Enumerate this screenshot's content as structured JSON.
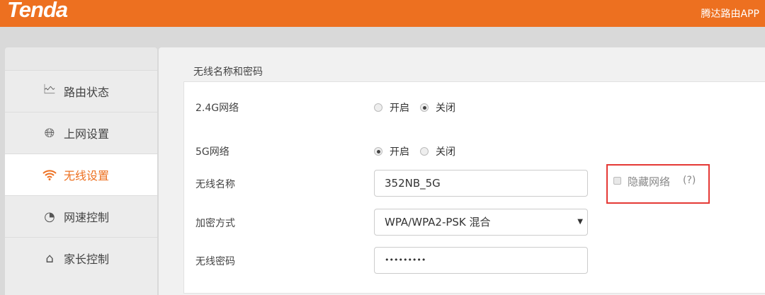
{
  "header": {
    "logo": "Tenda",
    "app_link": "腾达路由APP",
    "color": "#ed7020"
  },
  "sidebar": {
    "items": [
      {
        "label": "路由状态",
        "icon": "pulse-monitor-icon"
      },
      {
        "label": "上网设置",
        "icon": "globe-icon"
      },
      {
        "label": "无线设置",
        "icon": "wifi-icon",
        "active": true
      },
      {
        "label": "网速控制",
        "icon": "speedometer-icon"
      },
      {
        "label": "家长控制",
        "icon": "family-icon"
      }
    ]
  },
  "main": {
    "section_title": "无线名称和密码",
    "net24": {
      "label": "2.4G网络",
      "on": "开启",
      "off": "关闭",
      "value": "关闭"
    },
    "net5": {
      "label": "5G网络",
      "on": "开启",
      "off": "关闭",
      "value": "开启"
    },
    "ssid": {
      "label": "无线名称",
      "value": "352NB_5G"
    },
    "hide": {
      "label": "隐藏网络",
      "help": "(?)",
      "checked": false
    },
    "security": {
      "label": "加密方式",
      "value": "WPA/WPA2-PSK 混合"
    },
    "password": {
      "label": "无线密码",
      "value": "•••••••••"
    }
  }
}
